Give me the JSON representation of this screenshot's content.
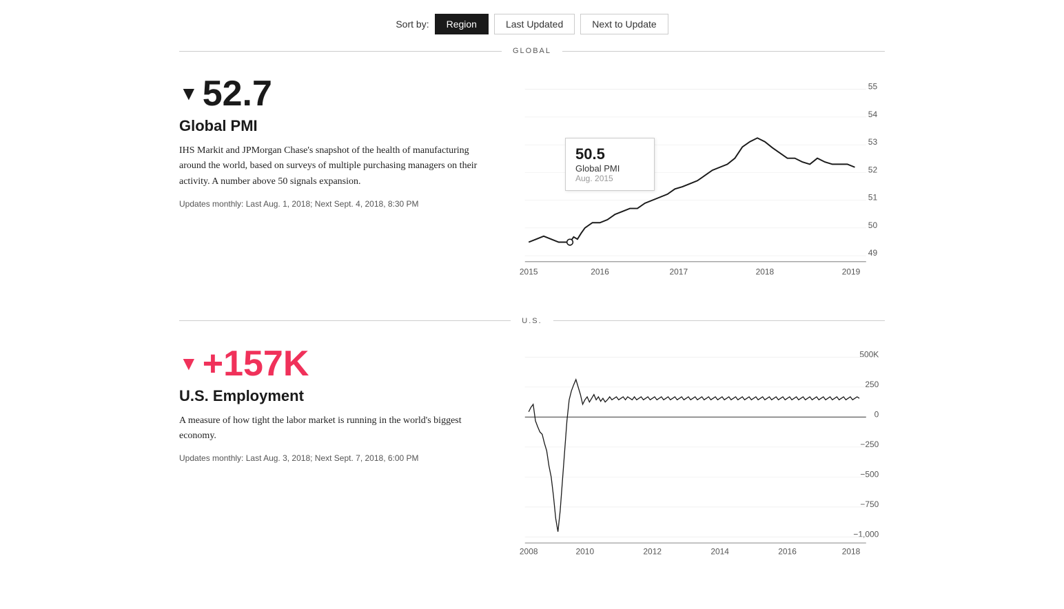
{
  "sort_bar": {
    "label": "Sort by:",
    "buttons": [
      {
        "id": "region",
        "label": "Region",
        "active": true
      },
      {
        "id": "last-updated",
        "label": "Last Updated",
        "active": false
      },
      {
        "id": "next-to-update",
        "label": "Next to Update",
        "active": false
      }
    ]
  },
  "sections": [
    {
      "id": "global",
      "label": "GLOBAL",
      "indicators": [
        {
          "id": "global-pmi",
          "value": "52.7",
          "arrow": "▼",
          "color": "dark",
          "title": "Global PMI",
          "description": "IHS Markit and JPMorgan Chase's snapshot of the health of manufacturing around the world, based on surveys of multiple purchasing managers on their activity. A number above 50 signals expansion.",
          "update_text": "Updates monthly: Last Aug. 1, 2018; Next Sept. 4, 2018, 8:30 PM",
          "tooltip": {
            "value": "50.5",
            "name": "Global PMI",
            "date": "Aug.  2015"
          },
          "chart": {
            "x_labels": [
              "2015",
              "2016",
              "2017",
              "2018",
              "2019"
            ],
            "y_labels": [
              "55",
              "54",
              "53",
              "52",
              "51",
              "50",
              "49"
            ],
            "y_min": 49,
            "y_max": 55
          }
        }
      ]
    },
    {
      "id": "us",
      "label": "U.S.",
      "indicators": [
        {
          "id": "us-employment",
          "value": "+157K",
          "arrow": "▼",
          "color": "pink",
          "title": "U.S. Employment",
          "description": "A measure of how tight the labor market is running in the world's biggest economy.",
          "update_text": "Updates monthly: Last Aug. 3, 2018; Next Sept. 7, 2018, 6:00 PM",
          "chart": {
            "x_labels": [
              "2008",
              "2010",
              "2012",
              "2014",
              "2016",
              "2018"
            ],
            "y_labels": [
              "500K",
              "250",
              "0",
              "−250",
              "−500",
              "−750",
              "−1,000"
            ]
          }
        }
      ]
    }
  ]
}
